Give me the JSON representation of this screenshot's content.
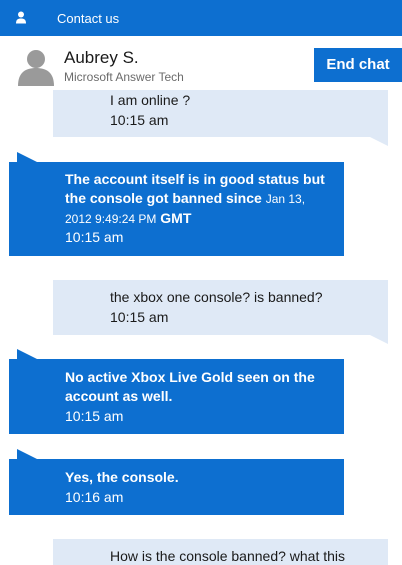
{
  "window": {
    "title": "Contact us",
    "title_icon": "person-icon"
  },
  "agent": {
    "name": "Aubrey S.",
    "role": "Microsoft Answer Tech",
    "avatar_icon": "avatar-placeholder-icon",
    "end_chat_label": "End chat"
  },
  "colors": {
    "brand_blue": "#0d6fd0",
    "user_bubble": "#dfe9f6",
    "agent_text": "#ffffff",
    "user_text": "#1a1a1a"
  },
  "messages": [
    {
      "sender": "user",
      "text": "I am online ?",
      "time": "10:15 am"
    },
    {
      "sender": "agent",
      "text_part1": "The account itself is in good status but the console got banned since",
      "text_small": "Jan 13, 2012 9:49:24 PM",
      "text_part2": "GMT",
      "time": "10:15 am"
    },
    {
      "sender": "user",
      "text": "the xbox one console? is banned?",
      "time": "10:15 am"
    },
    {
      "sender": "agent",
      "text": "No active Xbox Live Gold seen on the account as well.",
      "time": "10:15 am"
    },
    {
      "sender": "agent",
      "text": "Yes, the console.",
      "time": "10:16 am"
    },
    {
      "sender": "user",
      "text": "How is the console banned? what this",
      "time": ""
    }
  ]
}
